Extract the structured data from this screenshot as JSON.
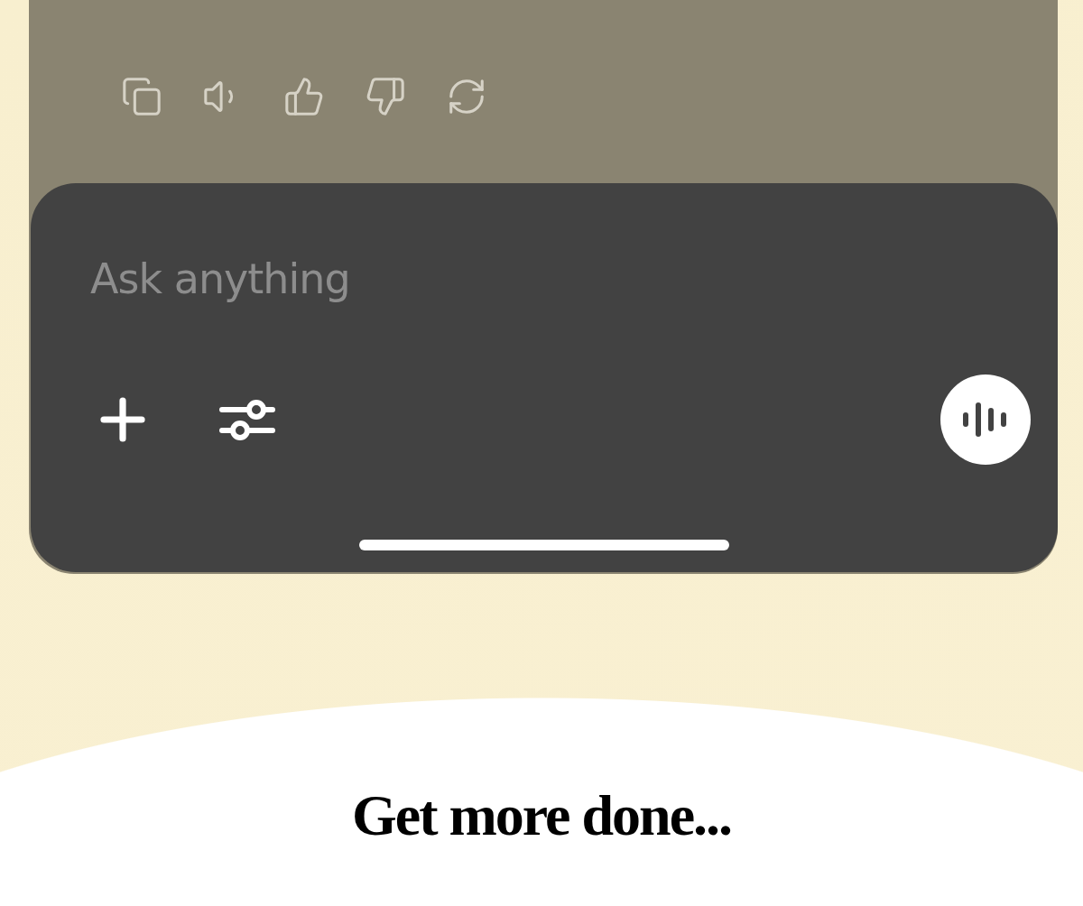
{
  "composer": {
    "placeholder": "Ask anything"
  },
  "headline": "Get more done..."
}
